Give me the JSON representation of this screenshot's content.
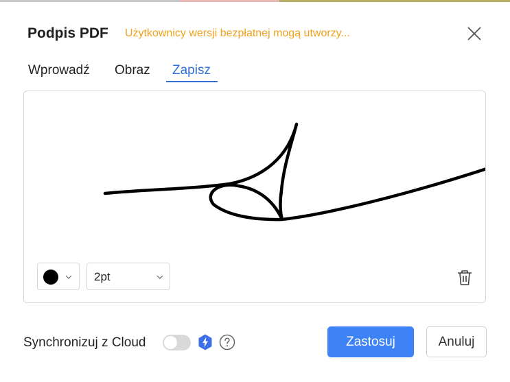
{
  "dialog": {
    "title": "Podpis PDF",
    "notice": "Użytkownicy wersji bezpłatnej mogą utworzy..."
  },
  "tabs": [
    {
      "label": "Wprowadź",
      "active": false
    },
    {
      "label": "Obraz",
      "active": false
    },
    {
      "label": "Zapisz",
      "active": true
    }
  ],
  "pen": {
    "color": "#000000",
    "size": "2pt"
  },
  "sync": {
    "label": "Synchronizuj z Cloud",
    "enabled": false
  },
  "buttons": {
    "apply": "Zastosuj",
    "cancel": "Anuluj"
  },
  "colors": {
    "accent": "#3d82f7",
    "tab_active": "#2f6fd8",
    "notice": "#f0a21b"
  },
  "icons": [
    "close-icon",
    "chevron-down-icon",
    "trash-icon",
    "bolt-icon",
    "help-icon"
  ]
}
